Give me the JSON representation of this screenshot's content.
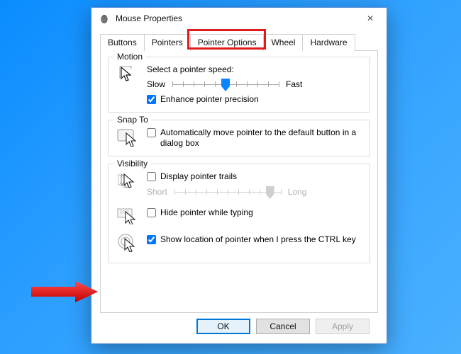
{
  "window": {
    "title": "Mouse Properties",
    "close_glyph": "✕"
  },
  "tabs": [
    "Buttons",
    "Pointers",
    "Pointer Options",
    "Wheel",
    "Hardware"
  ],
  "active_tab_index": 2,
  "motion": {
    "title": "Motion",
    "label": "Select a pointer speed:",
    "slow": "Slow",
    "fast": "Fast",
    "slider_value": 5,
    "slider_max": 10,
    "enhance_label": "Enhance pointer precision",
    "enhance_checked": true
  },
  "snap": {
    "title": "Snap To",
    "label": "Automatically move pointer to the default button in a dialog box",
    "checked": false
  },
  "vis": {
    "title": "Visibility",
    "trails_label": "Display pointer trails",
    "trails_checked": false,
    "short": "Short",
    "long": "Long",
    "trails_value": 9,
    "trails_max": 10,
    "hide_label": "Hide pointer while typing",
    "hide_checked": false,
    "ctrl_label": "Show location of pointer when I press the CTRL key",
    "ctrl_checked": true
  },
  "buttons": {
    "ok": "OK",
    "cancel": "Cancel",
    "apply": "Apply"
  },
  "annotation": {
    "tab_highlight_on_index": 2,
    "arrow_points_to": "ctrl_checkbox"
  }
}
